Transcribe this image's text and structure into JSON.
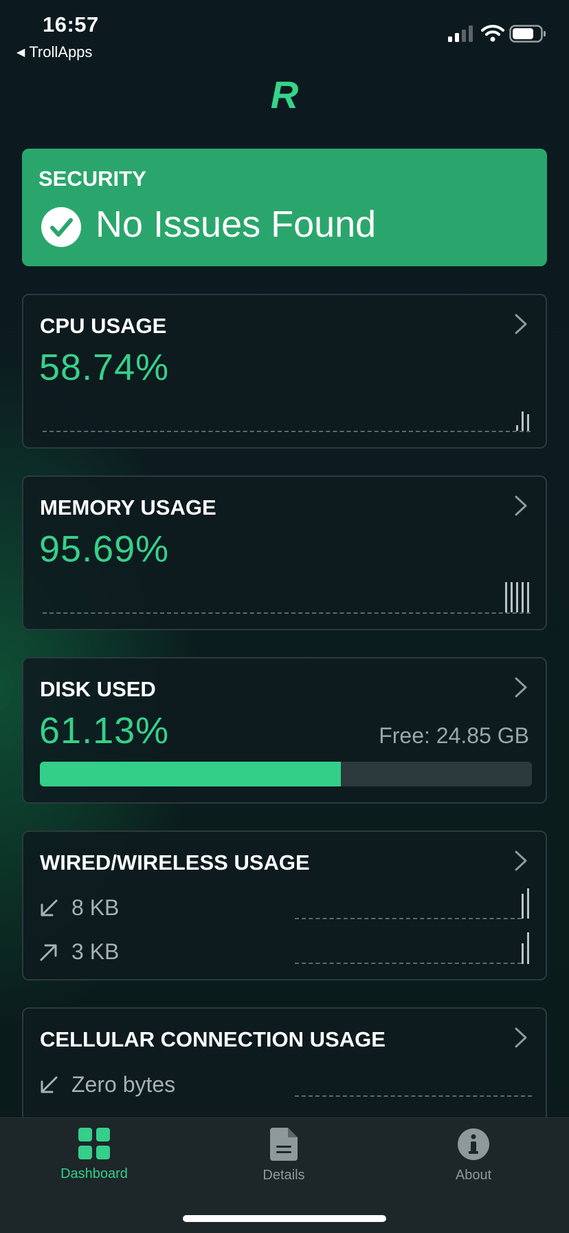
{
  "status_bar": {
    "time": "16:57",
    "back_app": "TrollApps"
  },
  "app": {
    "logo": "R",
    "accent_color": "#35cf8a"
  },
  "security": {
    "title": "SECURITY",
    "status": "No Issues Found",
    "icon": "checkmark-circle-icon"
  },
  "cpu": {
    "title": "CPU USAGE",
    "value": "58.74%"
  },
  "memory": {
    "title": "MEMORY USAGE",
    "value": "95.69%"
  },
  "disk": {
    "title": "DISK USED",
    "value": "61.13%",
    "free": "Free: 24.85 GB",
    "used_fraction": 0.6113
  },
  "network": {
    "title": "WIRED/WIRELESS USAGE",
    "download": "8 KB",
    "upload": "3 KB"
  },
  "cellular": {
    "title": "CELLULAR CONNECTION USAGE",
    "download": "Zero bytes"
  },
  "tabs": [
    {
      "label": "Dashboard",
      "icon": "grid-icon",
      "active": true
    },
    {
      "label": "Details",
      "icon": "document-icon",
      "active": false
    },
    {
      "label": "About",
      "icon": "info-icon",
      "active": false
    }
  ]
}
